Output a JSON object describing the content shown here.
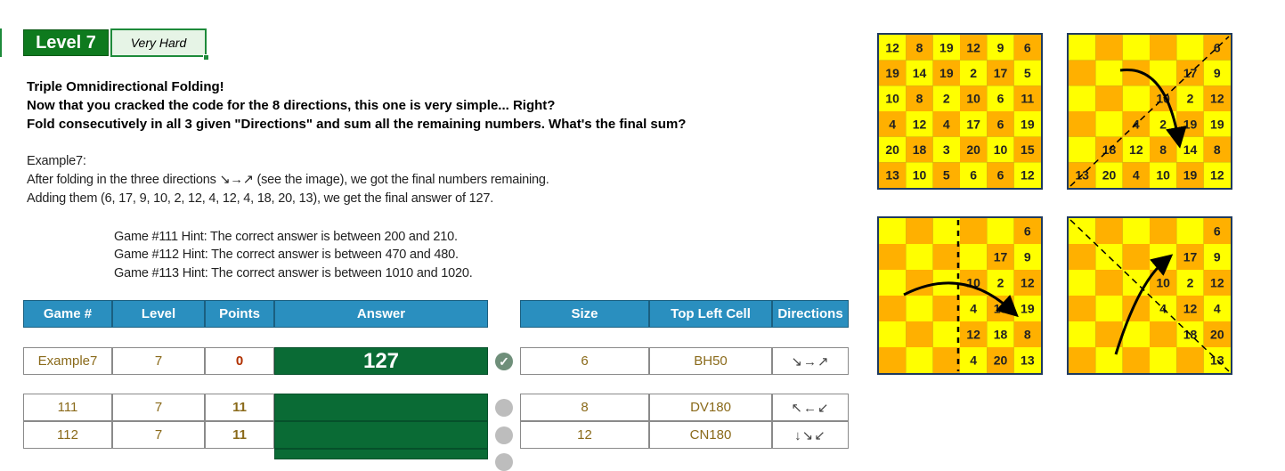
{
  "level": {
    "label": "Level 7",
    "difficulty": "Very Hard"
  },
  "intro": {
    "line1": "Triple Omnidirectional Folding!",
    "line2": "Now that you cracked the code for the 8 directions, this one is very simple... Right?",
    "line3": "Fold consecutively in all 3 given \"Directions\" and sum all the remaining numbers. What's the final sum?"
  },
  "example": {
    "title": "Example7:",
    "line1": "After folding in the three directions ↘→↗ (see the image), we got the final numbers remaining.",
    "line2": "Adding them (6, 17, 9, 10, 2, 12, 4, 12, 4, 18, 20, 13), we get the final answer of 127."
  },
  "hints": [
    "Game #111 Hint: The correct answer is between 200 and 210.",
    "Game #112 Hint: The correct answer is between 470 and 480.",
    "Game #113 Hint: The correct answer is between 1010 and 1020."
  ],
  "table_left_headers": [
    "Game #",
    "Level",
    "Points",
    "Answer"
  ],
  "table_right_headers": [
    "Size",
    "Top Left Cell",
    "Directions"
  ],
  "rows": [
    {
      "game": "Example7",
      "level": "7",
      "points": "0",
      "answer": "127",
      "status": "correct",
      "size": "6",
      "cell": "BH50",
      "dirs": "↘→↗"
    },
    {
      "game": "111",
      "level": "7",
      "points": "11",
      "answer": "",
      "status": "pending",
      "size": "8",
      "cell": "DV180",
      "dirs": "↖←↙"
    },
    {
      "game": "112",
      "level": "7",
      "points": "11",
      "answer": "",
      "status": "pending",
      "size": "12",
      "cell": "CN180",
      "dirs": "↓↘↙"
    }
  ],
  "status_icons": {
    "correct": "check-circle-icon",
    "pending": "grey-circle-icon"
  },
  "colors": {
    "yellow": "#ffff00",
    "orange": "#ffb000",
    "answer_green": "#0a6b35",
    "header_blue": "#2a8fbf",
    "level_green": "#0e7a1e"
  },
  "grid_full": [
    [
      "12",
      "8",
      "19",
      "12",
      "9",
      "6"
    ],
    [
      "19",
      "14",
      "19",
      "2",
      "17",
      "5"
    ],
    [
      "10",
      "8",
      "2",
      "10",
      "6",
      "11"
    ],
    [
      "4",
      "12",
      "4",
      "17",
      "6",
      "19"
    ],
    [
      "20",
      "18",
      "3",
      "20",
      "10",
      "15"
    ],
    [
      "13",
      "10",
      "5",
      "6",
      "6",
      "12"
    ]
  ],
  "grid_fold1": [
    [
      "",
      "",
      "",
      "",
      "",
      "6"
    ],
    [
      "",
      "",
      "",
      "",
      "17",
      "9"
    ],
    [
      "",
      "",
      "",
      "10",
      "2",
      "12"
    ],
    [
      "",
      "",
      "4",
      "2",
      "19",
      "19"
    ],
    [
      "",
      "18",
      "12",
      "8",
      "14",
      "8"
    ],
    [
      "13",
      "20",
      "4",
      "10",
      "19",
      "12"
    ]
  ],
  "grid_fold2": [
    [
      "",
      "",
      "",
      "",
      "",
      "6"
    ],
    [
      "",
      "",
      "",
      "",
      "17",
      "9"
    ],
    [
      "",
      "",
      "",
      "10",
      "2",
      "12"
    ],
    [
      "",
      "",
      "",
      "4",
      "19",
      "19"
    ],
    [
      "",
      "",
      "",
      "12",
      "18",
      "8"
    ],
    [
      "",
      "",
      "",
      "4",
      "20",
      "13"
    ]
  ],
  "grid_fold3": [
    [
      "",
      "",
      "",
      "",
      "",
      "6"
    ],
    [
      "",
      "",
      "",
      "",
      "17",
      "9"
    ],
    [
      "",
      "",
      "",
      "10",
      "2",
      "12"
    ],
    [
      "",
      "",
      "",
      "4",
      "12",
      "4"
    ],
    [
      "",
      "",
      "",
      "",
      "18",
      "20"
    ],
    [
      "",
      "",
      "",
      "",
      "",
      "13"
    ]
  ]
}
